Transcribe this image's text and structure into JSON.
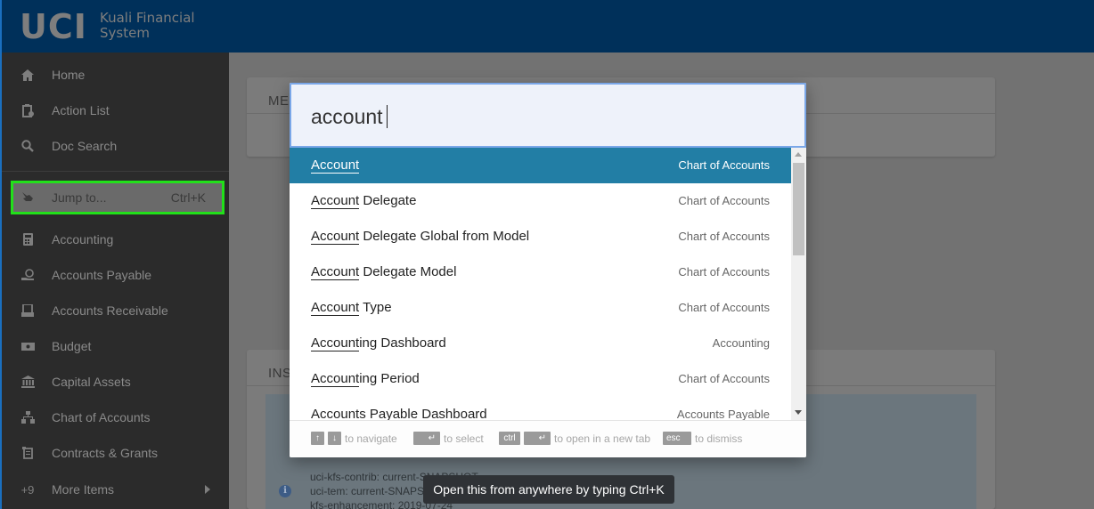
{
  "header": {
    "logo_mark": "UCI",
    "app_name_line1": "Kuali Financial",
    "app_name_line2": "System"
  },
  "sidebar": {
    "top_items": [
      {
        "label": "Home",
        "icon": "home-icon"
      },
      {
        "label": "Action List",
        "icon": "clipboard-check-icon"
      },
      {
        "label": "Doc Search",
        "icon": "search-icon"
      }
    ],
    "jump": {
      "label": "Jump to...",
      "shortcut": "Ctrl+K",
      "icon": "rabbit-icon"
    },
    "modules": [
      {
        "label": "Accounting",
        "icon": "calculator-icon"
      },
      {
        "label": "Accounts Payable",
        "icon": "hand-coin-icon"
      },
      {
        "label": "Accounts Receivable",
        "icon": "invoice-icon"
      },
      {
        "label": "Budget",
        "icon": "money-icon"
      },
      {
        "label": "Capital Assets",
        "icon": "bank-icon"
      },
      {
        "label": "Chart of Accounts",
        "icon": "hierarchy-icon"
      },
      {
        "label": "Contracts & Grants",
        "icon": "contract-icon"
      }
    ],
    "more": {
      "count": "+9",
      "label": "More Items"
    }
  },
  "background": {
    "card1_title": "ME",
    "card2_title": "INS",
    "info_lines": [
      "uci-kfs-contrib: current-SNAPSHOT",
      "uci-tem: current-SNAPSHOT",
      "kfs-enhancement: 2019-07-24"
    ]
  },
  "jump_modal": {
    "query": "account",
    "results": [
      {
        "match": "Account",
        "rest": "",
        "category": "Chart of Accounts",
        "active": true
      },
      {
        "match": "Account",
        "rest": " Delegate",
        "category": "Chart of Accounts",
        "active": false
      },
      {
        "match": "Account",
        "rest": " Delegate Global from Model",
        "category": "Chart of Accounts",
        "active": false
      },
      {
        "match": "Account",
        "rest": " Delegate Model",
        "category": "Chart of Accounts",
        "active": false
      },
      {
        "match": "Account",
        "rest": " Type",
        "category": "Chart of Accounts",
        "active": false
      },
      {
        "match": "Account",
        "rest": "ing Dashboard",
        "category": "Accounting",
        "active": false
      },
      {
        "match": "Account",
        "rest": "ing Period",
        "category": "Chart of Accounts",
        "active": false
      },
      {
        "match": "",
        "rest": "Accounts Payable Dashboard",
        "category": "Accounts Payable",
        "active": false
      }
    ],
    "hints": {
      "navigate": "to navigate",
      "select": "to select",
      "ctrl_key": "ctrl",
      "new_tab": "to open in a new tab",
      "esc_key": "esc",
      "dismiss": "to dismiss"
    }
  },
  "tooltip": "Open this from anywhere by typing Ctrl+K",
  "colors": {
    "header_bg": "#00305a",
    "sidebar_bg": "#2b2b2b",
    "active_row": "#227ea5",
    "highlight_border": "#22e01a"
  }
}
